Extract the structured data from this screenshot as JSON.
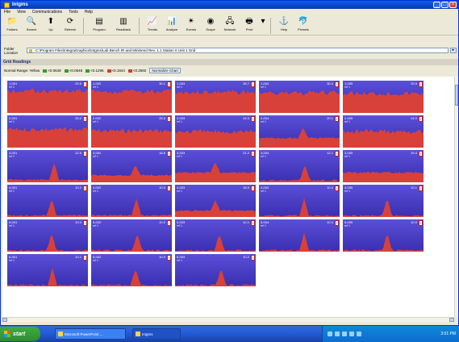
{
  "window": {
    "title": "Intgms",
    "controls": {
      "minimize": "_",
      "maximize": "□",
      "close": "×"
    }
  },
  "menubar": [
    "File",
    "View",
    "Communications",
    "Tools",
    "Help"
  ],
  "toolbar": {
    "groups": [
      [
        {
          "label": "Folders",
          "icon": "folder-icon",
          "glyph": "📁"
        },
        {
          "label": "Search",
          "icon": "search-icon",
          "glyph": "🔍"
        },
        {
          "label": "Up",
          "icon": "up-icon",
          "glyph": "⬆"
        },
        {
          "label": "Refresh",
          "icon": "refresh-icon",
          "glyph": "⟳"
        }
      ],
      [
        {
          "label": "Program",
          "icon": "program-icon",
          "glyph": "▤",
          "wide": true
        },
        {
          "label": "Readback",
          "icon": "readback-icon",
          "glyph": "▥",
          "wide": true
        }
      ],
      [
        {
          "label": "Trends",
          "icon": "trends-icon",
          "glyph": "📈"
        },
        {
          "label": "Analyze",
          "icon": "analyze-icon",
          "glyph": "📊"
        },
        {
          "label": "Events",
          "icon": "events-icon",
          "glyph": "✴"
        },
        {
          "label": "Scope",
          "icon": "scope-icon",
          "glyph": "◉"
        },
        {
          "label": "Network",
          "icon": "network-icon",
          "glyph": "🖧"
        },
        {
          "label": "Print",
          "icon": "print-icon",
          "glyph": "🖶"
        },
        {
          "label": "",
          "icon": "dropdown-icon",
          "glyph": "▾",
          "narrow": true
        }
      ],
      [
        {
          "label": "Help",
          "icon": "help-icon",
          "glyph": "⚓"
        },
        {
          "label": "Presets",
          "icon": "presets-icon",
          "glyph": "🐬"
        }
      ]
    ]
  },
  "address": {
    "label": "Folder Location",
    "value": "C:\\Program Files\\IntegraGraphics\\Intgms\\Lab Bench   IR and Minitrend   Rev. 1.1   Station 0   Unit 1   Grid",
    "go": "▸"
  },
  "section": {
    "title": "Grid Readings"
  },
  "legend": {
    "items": [
      {
        "label": "Normal Range: Yellow",
        "color": ""
      },
      {
        "label": "<0.0648",
        "color": "#2aa02a"
      },
      {
        "label": "<0.0648",
        "color": "#2aa02a"
      },
      {
        "label": "<0.1296",
        "color": "#2aa02a"
      },
      {
        "label": "<0.1944",
        "color": "#d23b2e"
      },
      {
        "label": "<0.2592",
        "color": "#d23b2e"
      }
    ],
    "button": "Normalize Chart"
  },
  "chart_data": {
    "type": "area",
    "tiles": [
      {
        "name": "1-001",
        "sub": "ref 1",
        "value": "29.6",
        "red": 0.68,
        "peaks": []
      },
      {
        "name": "1-002",
        "sub": "ref 1",
        "value": "30.1",
        "red": 0.66,
        "peaks": []
      },
      {
        "name": "1-003",
        "sub": "ref 1",
        "value": "28.7",
        "red": 0.64,
        "peaks": []
      },
      {
        "name": "1-004",
        "sub": "ref 1",
        "value": "30.4",
        "red": 0.62,
        "peaks": []
      },
      {
        "name": "1-005",
        "sub": "ref 1",
        "value": "29.9",
        "red": 0.6,
        "peaks": []
      },
      {
        "name": "2-001",
        "sub": "ref 1",
        "value": "25.2",
        "red": 0.56,
        "peaks": []
      },
      {
        "name": "2-002",
        "sub": "ref 1",
        "value": "25.8",
        "red": 0.52,
        "peaks": []
      },
      {
        "name": "2-003",
        "sub": "ref 1",
        "value": "24.9",
        "red": 0.5,
        "peaks": []
      },
      {
        "name": "2-004",
        "sub": "ref 1",
        "value": "20.1",
        "red": 0.3,
        "peaks": [
          0.55
        ]
      },
      {
        "name": "2-005",
        "sub": "ref 1",
        "value": "24.0",
        "red": 0.5,
        "peaks": []
      },
      {
        "name": "3-001",
        "sub": "ref 1",
        "value": "12.5",
        "red": 0.08,
        "peaks": [
          0.58
        ]
      },
      {
        "name": "3-002",
        "sub": "ref 1",
        "value": "18.6",
        "red": 0.22,
        "peaks": [
          0.55
        ]
      },
      {
        "name": "3-003",
        "sub": "ref 1",
        "value": "21.2",
        "red": 0.3,
        "peaks": [
          0.5
        ]
      },
      {
        "name": "3-004",
        "sub": "ref 1",
        "value": "12.1",
        "red": 0.06,
        "peaks": [
          0.57
        ]
      },
      {
        "name": "3-005",
        "sub": "ref 1",
        "value": "19.4",
        "red": 0.3,
        "peaks": []
      },
      {
        "name": "4-001",
        "sub": "ref 1",
        "value": "10.2",
        "red": 0.05,
        "peaks": [
          0.55
        ]
      },
      {
        "name": "4-002",
        "sub": "ref 1",
        "value": "10.0",
        "red": 0.05,
        "peaks": [
          0.56
        ]
      },
      {
        "name": "4-003",
        "sub": "ref 1",
        "value": "18.9",
        "red": 0.2,
        "peaks": [
          0.5
        ]
      },
      {
        "name": "4-004",
        "sub": "ref 1",
        "value": "10.4",
        "red": 0.04,
        "peaks": [
          0.56
        ]
      },
      {
        "name": "4-005",
        "sub": "ref 1",
        "value": "10.1",
        "red": 0.04,
        "peaks": [
          0.55
        ]
      },
      {
        "name": "5-001",
        "sub": "ref 1",
        "value": "10.0",
        "red": 0.04,
        "peaks": [
          0.55
        ]
      },
      {
        "name": "5-002",
        "sub": "ref 1",
        "value": "10.2",
        "red": 0.04,
        "peaks": [
          0.57
        ]
      },
      {
        "name": "5-003",
        "sub": "ref 1",
        "value": "10.1",
        "red": 0.04,
        "peaks": [
          0.55
        ]
      },
      {
        "name": "5-004",
        "sub": "ref 1",
        "value": "10.3",
        "red": 0.04,
        "peaks": [
          0.56
        ]
      },
      {
        "name": "5-005",
        "sub": "ref 1",
        "value": "10.0",
        "red": 0.04,
        "peaks": [
          0.55
        ]
      },
      {
        "name": "6-001",
        "sub": "ref 1",
        "value": "10.1",
        "red": 0.04,
        "peaks": [
          0.56
        ]
      },
      {
        "name": "6-002",
        "sub": "ref 1",
        "value": "10.0",
        "red": 0.04,
        "peaks": [
          0.55
        ]
      },
      {
        "name": "6-003",
        "sub": "ref 1",
        "value": "10.2",
        "red": 0.04,
        "peaks": [
          0.57
        ]
      }
    ],
    "colors": {
      "fill_low": "#d8413a",
      "bg_top": "#5a4fd8",
      "bg_bottom": "#3a2fb0"
    }
  },
  "taskbar": {
    "start": "start",
    "tasks": [
      {
        "label": "Microsoft PowerPoint ...",
        "active": false
      },
      {
        "label": "Intgms",
        "active": true
      }
    ],
    "tray_clock": "3:01 PM"
  }
}
